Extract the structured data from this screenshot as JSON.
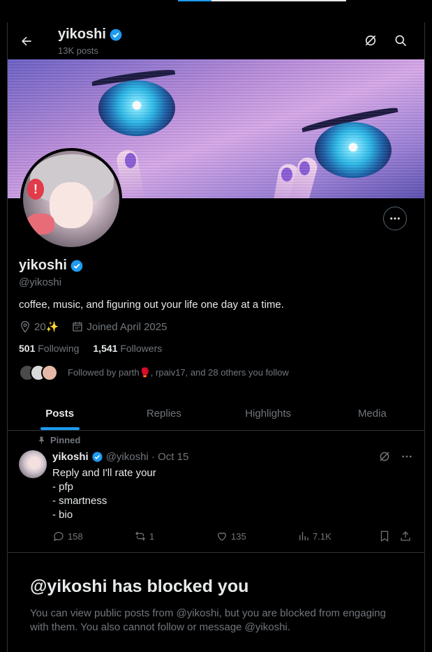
{
  "header": {
    "title": "yikoshi",
    "posts_count": "13K posts"
  },
  "profile": {
    "display_name": "yikoshi",
    "handle": "@yikoshi",
    "bio": "coffee, music, and figuring out your life one day at a time.",
    "location": "20✨",
    "joined": "Joined April 2025",
    "following_count": "501",
    "following_label": "Following",
    "followers_count": "1,541",
    "followers_label": "Followers",
    "followed_by": "Followed by parth🥊, rpaiv17, and 28 others you follow"
  },
  "tabs": [
    {
      "label": "Posts",
      "active": true
    },
    {
      "label": "Replies",
      "active": false
    },
    {
      "label": "Highlights",
      "active": false
    },
    {
      "label": "Media",
      "active": false
    }
  ],
  "post": {
    "pinned_label": "Pinned",
    "author": "yikoshi",
    "handle_date": "@yikoshi · Oct 15",
    "lines": [
      "Reply and I'll rate your",
      "- pfp",
      "- smartness",
      "- bio"
    ],
    "replies": "158",
    "reposts": "1",
    "likes": "135",
    "views": "7.1K"
  },
  "blocked": {
    "title": "@yikoshi has blocked you",
    "message": "You can view public posts from @yikoshi, but you are blocked from engaging with them. You also cannot follow or message @yikoshi."
  },
  "colors": {
    "accent": "#1d9bf0",
    "background": "#000000",
    "muted_text": "#71767b",
    "border": "#2f3336"
  },
  "icons": [
    "back-arrow-icon",
    "verified-badge-icon",
    "grok-icon",
    "search-icon",
    "more-icon",
    "location-icon",
    "calendar-icon",
    "pin-icon",
    "reply-icon",
    "repost-icon",
    "like-icon",
    "views-icon",
    "bookmark-icon",
    "share-icon"
  ]
}
